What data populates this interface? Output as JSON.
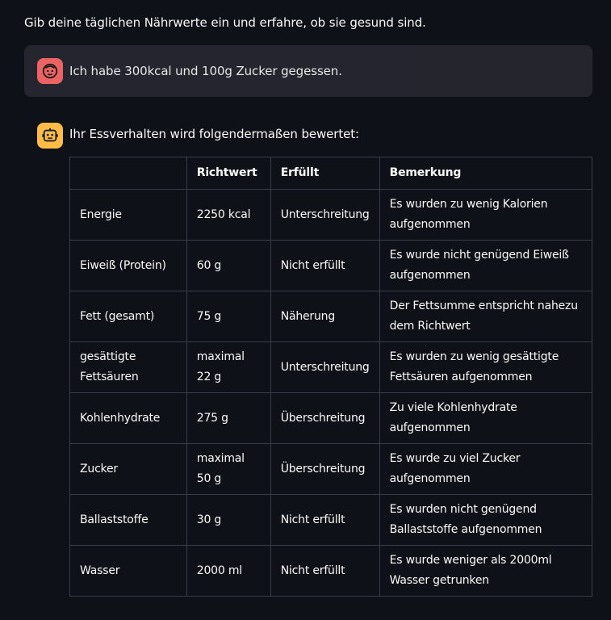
{
  "intro_text": "Gib deine täglichen Nährwerte ein und erfahre, ob sie gesund sind.",
  "user_message": {
    "text": "Ich habe 300kcal und 100g Zucker gegessen.",
    "avatar_icon": "user-face-icon",
    "avatar_color": "#ff6b6b"
  },
  "assistant_message": {
    "text": "Ihr Essverhalten wird folgendermaßen bewertet:",
    "avatar_icon": "robot-face-icon",
    "avatar_color": "#ffbd45"
  },
  "table": {
    "headers": [
      "",
      "Richtwert",
      "Erfüllt",
      "Bemerkung"
    ],
    "rows": [
      [
        "Energie",
        "2250 kcal",
        "Unterschreitung",
        "Es wurden zu wenig Kalorien aufgenommen"
      ],
      [
        "Eiweiß (Protein)",
        "60 g",
        "Nicht erfüllt",
        "Es wurde nicht genügend Eiweiß aufgenommen"
      ],
      [
        "Fett (gesamt)",
        "75 g",
        "Näherung",
        "Der Fettsumme entspricht nahezu dem Richtwert"
      ],
      [
        "gesättigte Fettsäuren",
        "maximal 22 g",
        "Unterschreitung",
        "Es wurden zu wenig gesättigte Fettsäuren aufgenommen"
      ],
      [
        "Kohlenhydrate",
        "275 g",
        "Überschreitung",
        "Zu viele Kohlenhydrate aufgenommen"
      ],
      [
        "Zucker",
        "maximal 50 g",
        "Überschreitung",
        "Es wurde zu viel Zucker aufgenommen"
      ],
      [
        "Ballaststoffe",
        "30 g",
        "Nicht erfüllt",
        "Es wurden nicht genügend Ballaststoffe aufgenommen"
      ],
      [
        "Wasser",
        "2000 ml",
        "Nicht erfüllt",
        "Es wurde weniger als 2000ml Wasser getrunken"
      ]
    ]
  }
}
